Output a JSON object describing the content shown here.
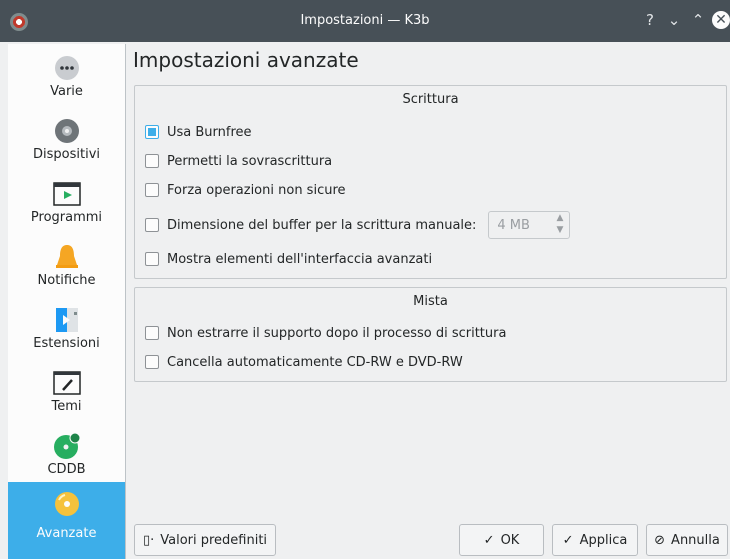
{
  "window": {
    "title": "Impostazioni — K3b",
    "help": "?",
    "minimize": "⌄",
    "maximize": "⌃",
    "close": "✕"
  },
  "sidebar": {
    "items": [
      {
        "label": "Varie",
        "icon": "more-dots-icon"
      },
      {
        "label": "Dispositivi",
        "icon": "disc-drive-icon"
      },
      {
        "label": "Programmi",
        "icon": "terminal-icon"
      },
      {
        "label": "Notifiche",
        "icon": "bell-icon"
      },
      {
        "label": "Estensioni",
        "icon": "plugin-icon"
      },
      {
        "label": "Temi",
        "icon": "theme-brush-icon"
      },
      {
        "label": "CDDB",
        "icon": "cddb-icon"
      },
      {
        "label": "Avanzate",
        "icon": "advanced-disc-icon"
      }
    ],
    "active": "Avanzate"
  },
  "page": {
    "title": "Impostazioni avanzate"
  },
  "writing": {
    "title": "Scrittura",
    "options": [
      {
        "label": "Usa Burnfree",
        "checked": true
      },
      {
        "label": "Permetti la sovrascrittura",
        "checked": false
      },
      {
        "label": "Forza operazioni non sicure",
        "checked": false
      },
      {
        "label": "Dimensione del buffer per la scrittura manuale:",
        "checked": false
      },
      {
        "label": "Mostra elementi dell'interfaccia avanzati",
        "checked": false
      }
    ],
    "buffer_value": "4 MB"
  },
  "misc": {
    "title": "Mista",
    "options": [
      {
        "label": "Non estrarre il supporto dopo il processo di scrittura",
        "checked": false
      },
      {
        "label": "Cancella automaticamente CD-RW e DVD-RW",
        "checked": false
      }
    ]
  },
  "buttons": {
    "defaults": "Valori predefiniti",
    "ok": "OK",
    "apply": "Applica",
    "cancel": "Annulla"
  },
  "colors": {
    "accent": "#3daee9",
    "titlebar": "#475057"
  }
}
